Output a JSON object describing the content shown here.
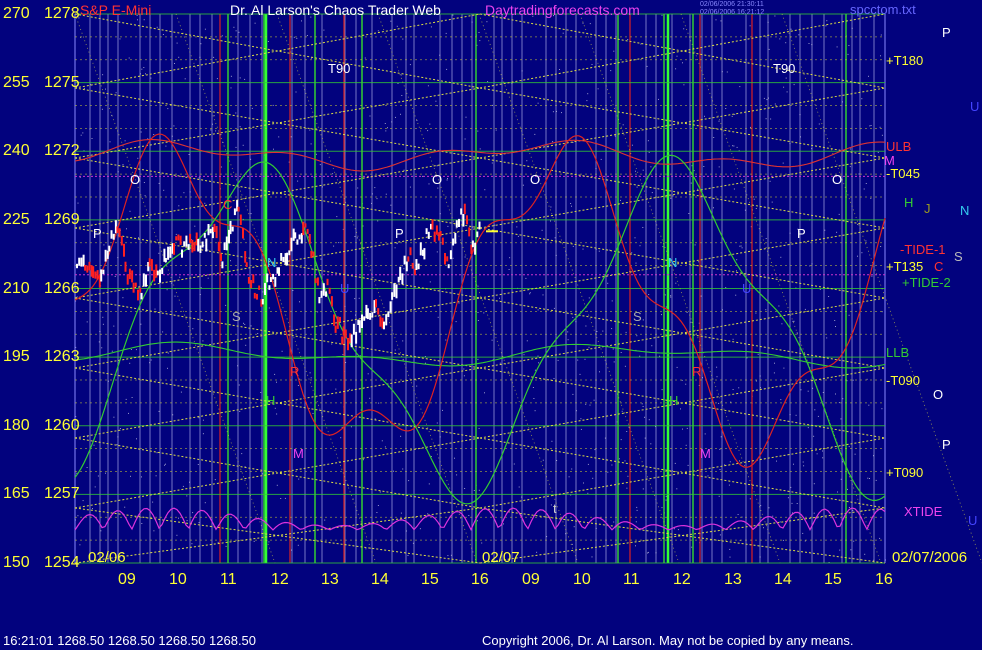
{
  "header": {
    "instrument": "S&P E-Mini",
    "title": "Dr. Al Larson's Chaos Trader Web",
    "site": "Daytradingforecasts.com",
    "stamp1": "02/06/2006 21:30:11",
    "stamp2": "02/06/2006 16:21:12",
    "file": "spcctom.txt"
  },
  "footer": {
    "quote": "16:21:01  1268.50 1268.50 1268.50 1268.50",
    "copyright": "Copyright 2006, Dr. Al Larson. May not be copied by any means."
  },
  "colors": {
    "background": "#02027e",
    "price_up": "#ffffff",
    "price_down": "#ff2020",
    "grid_yellow": "#cccc33",
    "green_line": "#33cc33",
    "red_line": "#dd2222",
    "magenta_line": "#dd33dd"
  },
  "chart_data": {
    "type": "line",
    "title": "S&P E-Mini",
    "left_axis_outer": [
      "270",
      "255",
      "240",
      "225",
      "210",
      "195",
      "180",
      "165",
      "150"
    ],
    "left_axis_inner": [
      "1278",
      "1275",
      "1272",
      "1269",
      "1266",
      "1263",
      "1260",
      "1257",
      "1254"
    ],
    "price_range": [
      1254,
      1278
    ],
    "x_ticks": [
      "09",
      "10",
      "11",
      "12",
      "13",
      "14",
      "15",
      "16",
      "09",
      "10",
      "11",
      "12",
      "13",
      "14",
      "15",
      "16"
    ],
    "date_labels": [
      "02/06",
      "02/07",
      "02/07/2006"
    ],
    "right_labels": [
      "+T180",
      "ULB",
      "M",
      "-T045",
      "H",
      "J",
      "-TIDE-1",
      "+T135",
      "C",
      "+TIDE-2",
      "LLB",
      "-T090",
      "+T090",
      "XTIDE"
    ],
    "far_right_labels": [
      "P",
      "U",
      "N",
      "S",
      "O",
      "P",
      "U"
    ],
    "markers": [
      "T90",
      "T90",
      "O",
      "O",
      "O",
      "O",
      "P",
      "P",
      "P",
      "C",
      "N",
      "N",
      "S",
      "S",
      "H",
      "H",
      "M",
      "M",
      "R",
      "R",
      "t",
      "U",
      "U"
    ],
    "last_price": "1268.50",
    "series": [
      {
        "name": "S&P E-Mini",
        "price_path": [
          [
            0,
            1267.0
          ],
          [
            0.02,
            1267.3
          ],
          [
            0.04,
            1266.9
          ],
          [
            0.06,
            1266.4
          ],
          [
            0.08,
            1267.8
          ],
          [
            0.1,
            1268.6
          ],
          [
            0.12,
            1267.0
          ],
          [
            0.14,
            1266.2
          ],
          [
            0.16,
            1265.6
          ],
          [
            0.18,
            1267.0
          ],
          [
            0.2,
            1266.5
          ],
          [
            0.22,
            1267.5
          ],
          [
            0.24,
            1268.0
          ],
          [
            0.26,
            1267.8
          ],
          [
            0.28,
            1268.3
          ],
          [
            0.3,
            1267.7
          ],
          [
            0.32,
            1268.2
          ],
          [
            0.34,
            1268.8
          ],
          [
            0.36,
            1267.2
          ],
          [
            0.38,
            1268.5
          ],
          [
            0.4,
            1269.5
          ],
          [
            0.42,
            1266.8
          ],
          [
            0.44,
            1266.0
          ],
          [
            0.46,
            1265.7
          ],
          [
            0.48,
            1266.4
          ],
          [
            0.5,
            1266.9
          ],
          [
            0.52,
            1267.4
          ],
          [
            0.54,
            1268.2
          ],
          [
            0.56,
            1268.6
          ],
          [
            0.58,
            1267.8
          ],
          [
            0.6,
            1265.8
          ],
          [
            0.62,
            1266.0
          ],
          [
            0.64,
            1264.6
          ],
          [
            0.66,
            1264.0
          ],
          [
            0.68,
            1263.7
          ],
          [
            0.7,
            1264.4
          ],
          [
            0.72,
            1264.8
          ],
          [
            0.74,
            1265.0
          ],
          [
            0.76,
            1264.7
          ],
          [
            0.78,
            1265.3
          ],
          [
            0.8,
            1266.4
          ],
          [
            0.82,
            1267.5
          ],
          [
            0.84,
            1267.0
          ],
          [
            0.86,
            1267.9
          ],
          [
            0.88,
            1268.7
          ],
          [
            0.9,
            1268.1
          ],
          [
            0.92,
            1267.3
          ],
          [
            0.94,
            1268.6
          ],
          [
            0.96,
            1269.4
          ],
          [
            0.98,
            1267.8
          ],
          [
            1.0,
            1268.5
          ]
        ]
      },
      {
        "name": "ULB"
      },
      {
        "name": "LLB"
      },
      {
        "name": "-TIDE-1"
      },
      {
        "name": "+TIDE-2"
      },
      {
        "name": "XTIDE"
      }
    ]
  }
}
